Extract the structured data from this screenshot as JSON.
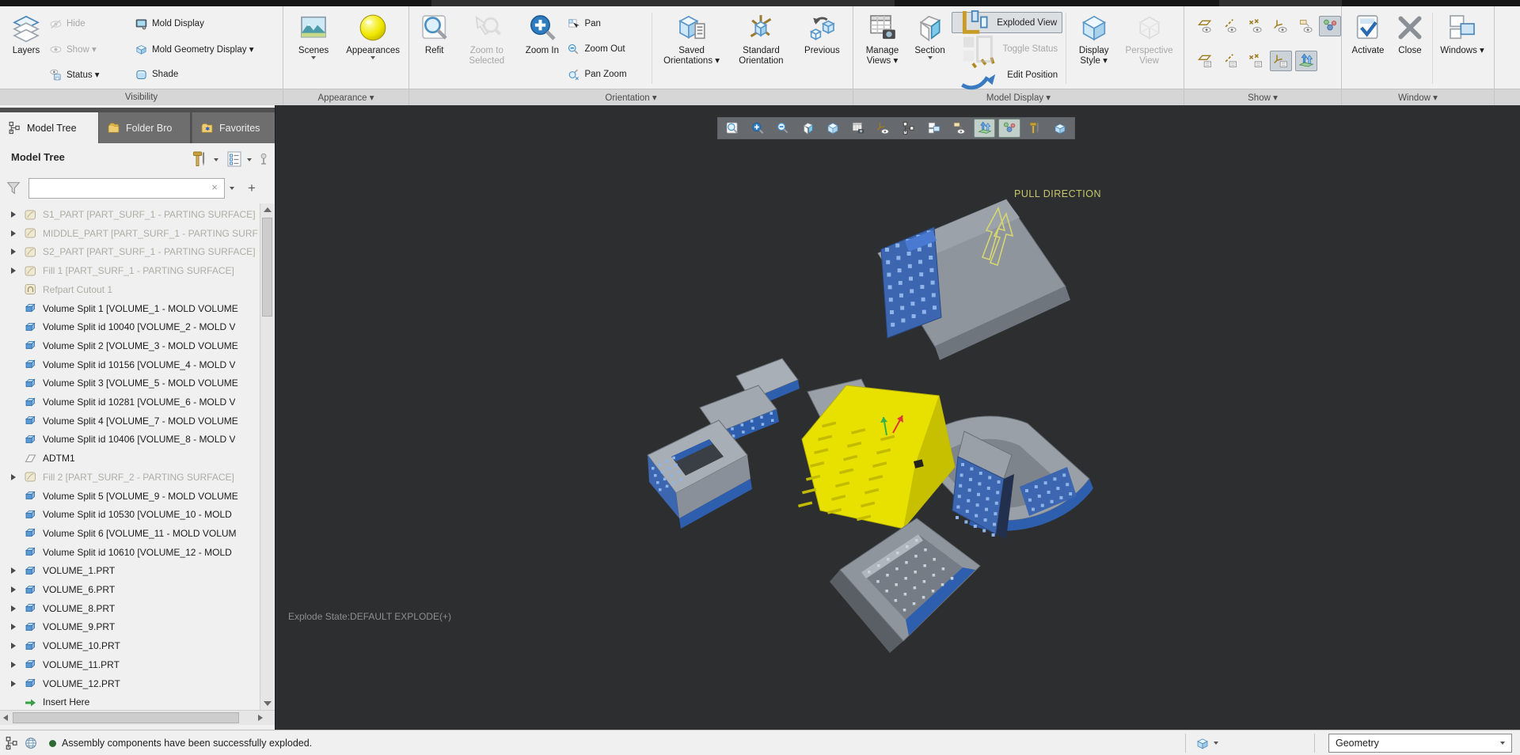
{
  "ribbon": {
    "group_labels": {
      "visibility": "Visibility",
      "appearance": "Appearance ▾",
      "orientation": "Orientation ▾",
      "model_display": "Model Display ▾",
      "show": "Show ▾",
      "window": "Window ▾"
    },
    "buttons": {
      "layers": "Layers",
      "hide": "Hide",
      "show": "Show ▾",
      "status": "Status ▾",
      "mold_display": "Mold Display",
      "mold_geometry_display": "Mold Geometry Display ▾",
      "shade": "Shade",
      "scenes": "Scenes",
      "appearances": "Appearances",
      "refit": "Refit",
      "zoom_to_selected": "Zoom to Selected",
      "zoom_in": "Zoom In",
      "pan": "Pan",
      "zoom_out": "Zoom Out",
      "pan_zoom": "Pan Zoom",
      "saved_orientations": "Saved Orientations ▾",
      "standard_orientation": "Standard Orientation",
      "previous": "Previous",
      "manage_views": "Manage Views ▾",
      "section": "Section",
      "exploded_view": "Exploded View",
      "toggle_status": "Toggle Status",
      "edit_position": "Edit Position",
      "display_style": "Display Style ▾",
      "perspective_view": "Perspective View",
      "activate": "Activate",
      "close": "Close",
      "windows": "Windows ▾"
    }
  },
  "panel": {
    "tabs": [
      {
        "label": "Model Tree"
      },
      {
        "label": "Folder Bro"
      },
      {
        "label": "Favorites"
      }
    ],
    "title": "Model Tree",
    "filter": {
      "value": "",
      "placeholder": ""
    },
    "insert_label": "Insert Here",
    "tree_items": [
      {
        "text": "S1_PART [PART_SURF_1 - PARTING SURFACE]",
        "icon": "quilt",
        "dim": true,
        "arrow": true
      },
      {
        "text": "MIDDLE_PART [PART_SURF_1 - PARTING SURF",
        "icon": "quilt",
        "dim": true,
        "arrow": true
      },
      {
        "text": "S2_PART [PART_SURF_1 - PARTING SURFACE]",
        "icon": "quilt",
        "dim": true,
        "arrow": true
      },
      {
        "text": "Fill 1 [PART_SURF_1 - PARTING SURFACE]",
        "icon": "quilt",
        "dim": true,
        "arrow": true
      },
      {
        "text": "Refpart Cutout 1",
        "icon": "cutout",
        "dim": true,
        "arrow": false
      },
      {
        "text": "Volume Split 1 [VOLUME_1 - MOLD VOLUME",
        "icon": "volume",
        "dim": false,
        "arrow": false
      },
      {
        "text": "Volume Split id 10040 [VOLUME_2 - MOLD V",
        "icon": "volume",
        "dim": false,
        "arrow": false
      },
      {
        "text": "Volume Split 2 [VOLUME_3 - MOLD VOLUME",
        "icon": "volume",
        "dim": false,
        "arrow": false
      },
      {
        "text": "Volume Split id 10156 [VOLUME_4 - MOLD V",
        "icon": "volume",
        "dim": false,
        "arrow": false
      },
      {
        "text": "Volume Split 3 [VOLUME_5 - MOLD VOLUME",
        "icon": "volume",
        "dim": false,
        "arrow": false
      },
      {
        "text": "Volume Split id 10281 [VOLUME_6 - MOLD V",
        "icon": "volume",
        "dim": false,
        "arrow": false
      },
      {
        "text": "Volume Split 4 [VOLUME_7 - MOLD VOLUME",
        "icon": "volume",
        "dim": false,
        "arrow": false
      },
      {
        "text": "Volume Split id 10406 [VOLUME_8 - MOLD V",
        "icon": "volume",
        "dim": false,
        "arrow": false
      },
      {
        "text": "ADTM1",
        "icon": "datum",
        "dim": false,
        "arrow": false
      },
      {
        "text": "Fill 2 [PART_SURF_2 - PARTING SURFACE]",
        "icon": "quilt",
        "dim": true,
        "arrow": true
      },
      {
        "text": "Volume Split 5 [VOLUME_9 - MOLD VOLUME",
        "icon": "volume",
        "dim": false,
        "arrow": false
      },
      {
        "text": "Volume Split id 10530 [VOLUME_10 - MOLD",
        "icon": "volume",
        "dim": false,
        "arrow": false
      },
      {
        "text": "Volume Split 6 [VOLUME_11 - MOLD VOLUM",
        "icon": "volume",
        "dim": false,
        "arrow": false
      },
      {
        "text": "Volume Split id 10610 [VOLUME_12 - MOLD",
        "icon": "volume",
        "dim": false,
        "arrow": false
      },
      {
        "text": "VOLUME_1.PRT",
        "icon": "volume",
        "dim": false,
        "arrow": true
      },
      {
        "text": "VOLUME_6.PRT",
        "icon": "volume",
        "dim": false,
        "arrow": true
      },
      {
        "text": "VOLUME_8.PRT",
        "icon": "volume",
        "dim": false,
        "arrow": true
      },
      {
        "text": "VOLUME_9.PRT",
        "icon": "volume",
        "dim": false,
        "arrow": true
      },
      {
        "text": "VOLUME_10.PRT",
        "icon": "volume",
        "dim": false,
        "arrow": true
      },
      {
        "text": "VOLUME_11.PRT",
        "icon": "volume",
        "dim": false,
        "arrow": true
      },
      {
        "text": "VOLUME_12.PRT",
        "icon": "volume",
        "dim": false,
        "arrow": true
      },
      {
        "text": "Insert Here",
        "icon": "insert",
        "dim": false,
        "arrow": false
      }
    ]
  },
  "viewport": {
    "pull_direction_label": "PULL DIRECTION",
    "explode_state": "Explode State:DEFAULT EXPLODE(+)",
    "toolbar_icons": [
      {
        "name": "zoom-region-icon",
        "sym": "s-mag",
        "active": false
      },
      {
        "name": "zoom-in-icon",
        "sym": "s-magplus",
        "active": false
      },
      {
        "name": "zoom-out-icon",
        "sym": "s-zoomout",
        "active": false
      },
      {
        "name": "section-icon",
        "sym": "s-section",
        "active": false
      },
      {
        "name": "display-style-icon",
        "sym": "s-dispstyle",
        "active": false
      },
      {
        "name": "view-manager-icon",
        "sym": "s-manageviews",
        "active": false
      },
      {
        "name": "datum-display-icon",
        "sym": "s-csyseye",
        "active": false
      },
      {
        "name": "tree-filter-icon",
        "sym": "s-treeglyph",
        "active": false
      },
      {
        "name": "windows-icon",
        "sym": "s-windows",
        "active": false
      },
      {
        "name": "annotation-display-icon",
        "sym": "s-annoteye",
        "active": false
      },
      {
        "name": "pull-direction-icon",
        "sym": "s-pulldir",
        "active": true
      },
      {
        "name": "spin-center-icon",
        "sym": "s-spincenter",
        "active": true
      },
      {
        "name": "appearance-icon",
        "sym": "s-tools",
        "active": false
      },
      {
        "name": "model-display-icon",
        "sym": "s-boxsel",
        "active": false
      }
    ]
  },
  "statusbar": {
    "message": "Assembly components have been successfully exploded.",
    "selection_filter": "Geometry"
  },
  "colors": {
    "accent_blue": "#3a7ab8",
    "mold_blue": "#2e5fae",
    "part_yellow": "#e8e100",
    "viewport_bg": "#2d2e30",
    "pull_text": "#c6c66e"
  }
}
